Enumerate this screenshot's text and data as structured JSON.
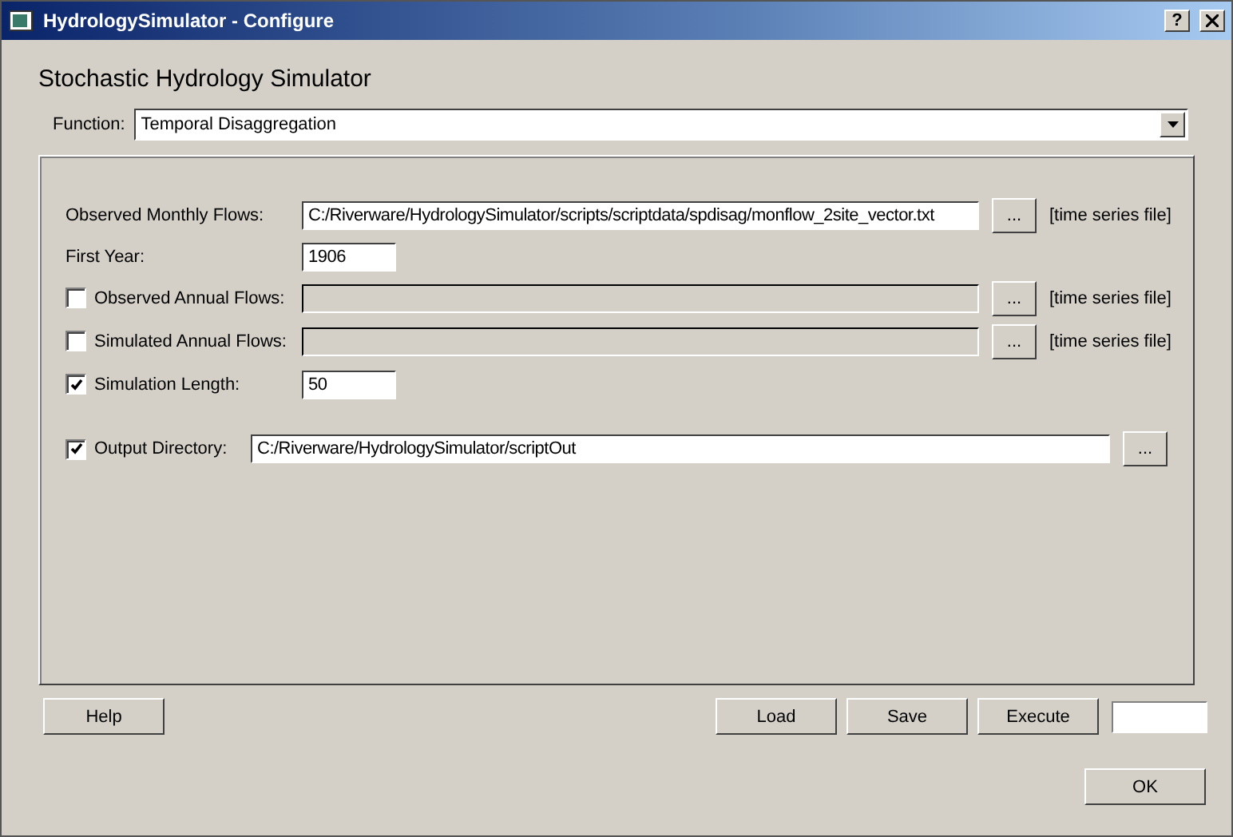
{
  "window": {
    "title": "HydrologySimulator - Configure",
    "help_glyph": "?"
  },
  "heading": "Stochastic Hydrology Simulator",
  "function": {
    "label": "Function:",
    "value": "Temporal Disaggregation"
  },
  "rows": [
    {
      "kind": "path",
      "label": "Observed Monthly Flows:",
      "value": "C:/Riverware/HydrologySimulator/scripts/scriptdata/spdisag/monflow_2site_vector.txt",
      "disabled": false,
      "browse": "...",
      "note": "[time series file]"
    },
    {
      "kind": "number",
      "label": "First Year:",
      "value": "1906"
    },
    {
      "kind": "path",
      "label": "Observed Annual Flows:",
      "checked": false,
      "disabled": true,
      "browse": "...",
      "note": "[time series file]"
    },
    {
      "kind": "path",
      "label": "Simulated Annual Flows:",
      "checked": false,
      "disabled": true,
      "browse": "...",
      "note": "[time series file]"
    },
    {
      "kind": "number",
      "label": "Simulation Length:",
      "checked": true,
      "value": "50"
    },
    {
      "kind": "directory",
      "label": "Output Directory:",
      "checked": true,
      "value": "C:/Riverware/HydrologySimulator/scriptOut",
      "disabled": false,
      "browse": "..."
    }
  ],
  "buttons_left": [
    "Help"
  ],
  "buttons_right": [
    "Load",
    "Save",
    "Execute"
  ],
  "ok": "OK"
}
